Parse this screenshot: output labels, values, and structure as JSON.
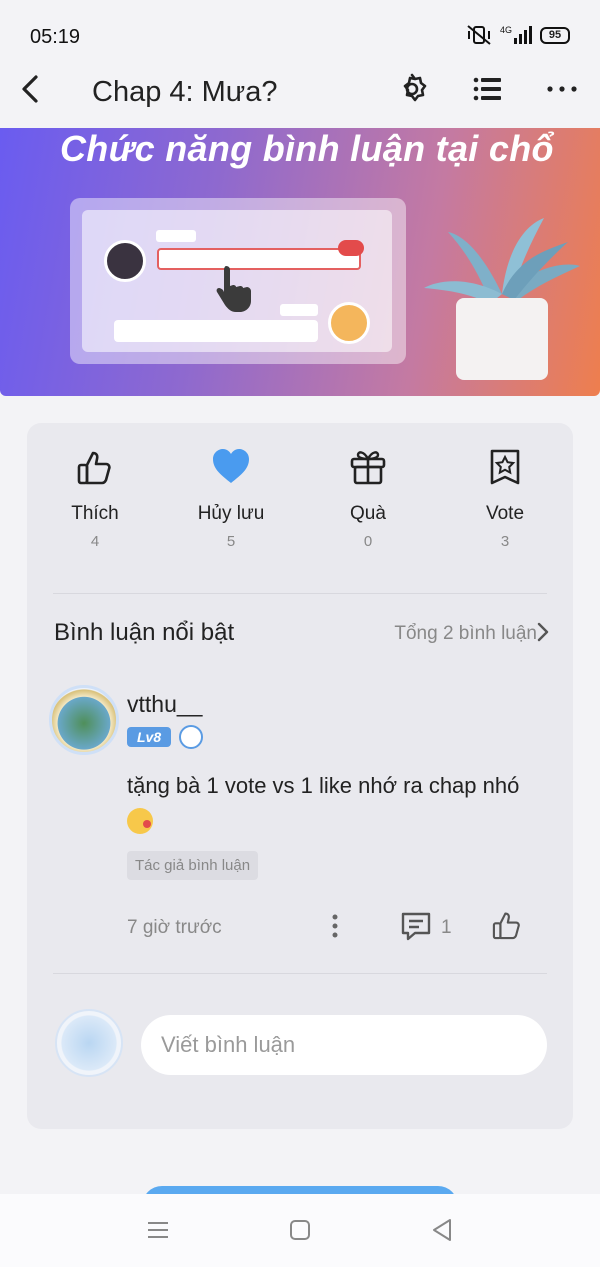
{
  "status_bar": {
    "time": "05:19",
    "battery": "95"
  },
  "header": {
    "title": "Chap 4: Mưa?"
  },
  "banner": {
    "title": "Chức năng bình luận tại chổ"
  },
  "actions": [
    {
      "label": "Thích",
      "count": "4",
      "icon": "thumbs-up-icon"
    },
    {
      "label": "Hủy lưu",
      "count": "5",
      "icon": "heart-icon"
    },
    {
      "label": "Quà",
      "count": "0",
      "icon": "gift-icon"
    },
    {
      "label": "Vote",
      "count": "3",
      "icon": "vote-icon"
    }
  ],
  "comments_section": {
    "title": "Bình luận nổi bật",
    "total": "Tổng 2 bình luận",
    "comment": {
      "username": "vtthu__",
      "level": "Lv8",
      "text": "tặng bà 1 vote vs 1 like nhớ ra chap nhó",
      "tag": "Tác giả bình luận",
      "time": "7 giờ trước",
      "reply_count": "1"
    },
    "input_placeholder": "Viết bình luận"
  },
  "colors": {
    "accent_blue": "#5a9be3",
    "heart_blue": "#4a9bef"
  }
}
